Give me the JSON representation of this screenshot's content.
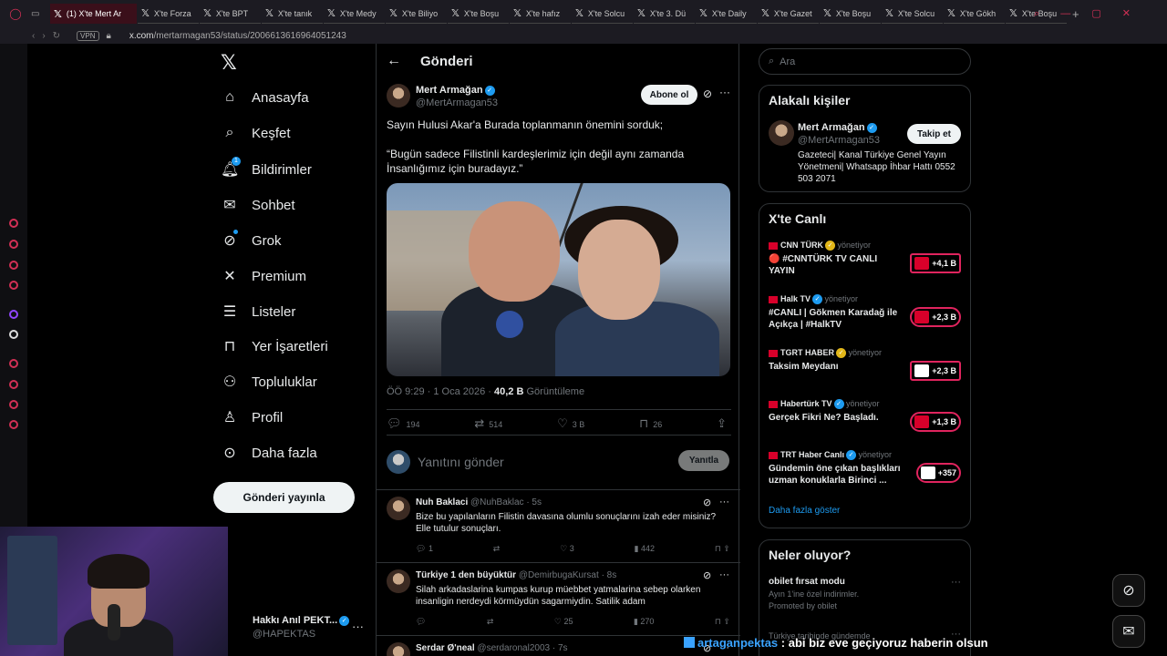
{
  "browser": {
    "tabs": [
      {
        "label": "(1) X'te Mert Ar",
        "active": true
      },
      {
        "label": "X'te Forza",
        "active": false
      },
      {
        "label": "X'te BPT",
        "active": false
      },
      {
        "label": "X'te tanık",
        "active": false
      },
      {
        "label": "X'te Medy",
        "active": false
      },
      {
        "label": "X'te Biliyo",
        "active": false
      },
      {
        "label": "X'te Boşu",
        "active": false
      },
      {
        "label": "X'te hafız",
        "active": false
      },
      {
        "label": "X'te Solcu",
        "active": false
      },
      {
        "label": "X'te 3. Dü",
        "active": false
      },
      {
        "label": "X'te Daily",
        "active": false
      },
      {
        "label": "X'te Gazet",
        "active": false
      },
      {
        "label": "X'te Boşu",
        "active": false
      },
      {
        "label": "X'te Solcu",
        "active": false
      },
      {
        "label": "X'te Gökh",
        "active": false
      },
      {
        "label": "X'te Boşu",
        "active": false
      }
    ],
    "new_tab": "+",
    "vpn": "VPN",
    "url_host": "x.com",
    "url_path": "/mertarmagan53/status/2006613616964051243"
  },
  "nav": {
    "items": [
      {
        "label": "Anasayfa",
        "icon": "home-icon",
        "glyph": "⌂"
      },
      {
        "label": "Keşfet",
        "icon": "search-icon",
        "glyph": "⌕"
      },
      {
        "label": "Bildirimler",
        "icon": "bell-icon",
        "glyph": "🔔︎"
      },
      {
        "label": "Sohbet",
        "icon": "mail-icon",
        "glyph": "✉"
      },
      {
        "label": "Grok",
        "icon": "grok-icon",
        "glyph": "⊘"
      },
      {
        "label": "Premium",
        "icon": "x-premium-icon",
        "glyph": "✕"
      },
      {
        "label": "Listeler",
        "icon": "list-icon",
        "glyph": "☰"
      },
      {
        "label": "Yer İşaretleri",
        "icon": "bookmark-icon",
        "glyph": "⊓"
      },
      {
        "label": "Topluluklar",
        "icon": "communities-icon",
        "glyph": "⚇"
      },
      {
        "label": "Profil",
        "icon": "profile-icon",
        "glyph": "♙"
      },
      {
        "label": "Daha fazla",
        "icon": "more-circle-icon",
        "glyph": "⊙"
      }
    ],
    "notification_count": "1",
    "post_button": "Gönderi yayınla",
    "account": {
      "name": "Hakkı Anıl PEKT...",
      "handle": "@HAPEKTAS"
    }
  },
  "main": {
    "title": "Gönderi",
    "post": {
      "name": "Mert Armağan",
      "handle": "@MertArmagan53",
      "subscribe": "Abone ol",
      "text1": "Sayın Hulusi Akar'a Burada toplanmanın önemini sorduk;",
      "text2": "“Bugün sadece Filistinli kardeşlerimiz için değil aynı zamanda İnsanlığımız için buradayız.”",
      "time": "ÖÖ 9:29 · 1 Oca 2026 · ",
      "views": "40,2 B",
      "views_label": " Görüntüleme",
      "replies": "194",
      "reposts": "514",
      "likes": "3 B",
      "bookmarks": "26"
    },
    "reply_box": {
      "placeholder": "Yanıtını gönder",
      "button": "Yanıtla"
    },
    "replies": [
      {
        "name": "Nuh Baklaci",
        "handle": "@NuhBaklac",
        "time": "· 5s",
        "text": "Bize bu yapılanların Filistin davasına olumlu sonuçlarını izah eder misiniz? Elle tutulur sonuçları.",
        "replies": "1",
        "reposts": "",
        "likes": "3",
        "views": "442"
      },
      {
        "name": "Türkiye 1 den büyüktür",
        "handle": "@DemirbugaKursat",
        "time": "· 8s",
        "text": "Silah arkadaslarina kumpas kurup müebbet yatmalarina sebep olarken insanligin nerdeydi körmüydün sagarmiydin. Satilik adam",
        "replies": "",
        "reposts": "",
        "likes": "25",
        "views": "270"
      },
      {
        "name": "Serdar Ø'neal",
        "handle": "@serdaronal2003",
        "time": "· 7s",
        "text": "",
        "replies": "",
        "reposts": "",
        "likes": "",
        "views": ""
      }
    ]
  },
  "right": {
    "search_placeholder": "Ara",
    "related": {
      "title": "Alakalı kişiler",
      "name": "Mert Armağan",
      "handle": "@MertArmagan53",
      "follow": "Takip et",
      "bio": "Gazeteci| Kanal Türkiye Genel Yayın Yönetmeni| Whatsapp İhbar Hattı 0552 503 2071"
    },
    "live": {
      "title": "X'te Canlı",
      "items": [
        {
          "host": "CNN TÜRK",
          "role": "yönetiyor",
          "title": "🔴 #CNNTÜRK TV CANLI YAYIN",
          "count": "+4,1 B",
          "badge_color": "#d8002a",
          "verified": "gold",
          "round": false
        },
        {
          "host": "Halk TV",
          "role": "yönetiyor",
          "title": "#CANLI | Gökmen Karadağ ile Açıkça | #HalkTV",
          "count": "+2,3 B",
          "badge_color": "#d8002a",
          "verified": "blue",
          "round": true
        },
        {
          "host": "TGRT HABER",
          "role": "yönetiyor",
          "title": "Taksim Meydanı",
          "count": "+2,3 B",
          "badge_color": "#ffffff",
          "verified": "gold",
          "round": false
        },
        {
          "host": "Habertürk TV",
          "role": "yönetiyor",
          "title": "Gerçek Fikri Ne? Başladı.",
          "count": "+1,3 B",
          "badge_color": "#d8002a",
          "verified": "blue",
          "round": true
        },
        {
          "host": "TRT Haber Canlı",
          "role": "yönetiyor",
          "title": "Gündemin öne çıkan başlıkları uzman konuklarla Birinci ...",
          "count": "+357",
          "badge_color": "#ffffff",
          "verified": "blue",
          "round": true
        }
      ],
      "show_more": "Daha fazla göster"
    },
    "trends": {
      "title": "Neler oluyor?",
      "items": [
        {
          "title": "obilet fırsat modu",
          "desc": "Ayın 1'ine özel indirimler.",
          "promo": "Promoted by obilet"
        },
        {
          "title": "",
          "desc": "Türkiye tarihinde gündemde",
          "promo": ""
        }
      ]
    }
  },
  "chat_overlay": {
    "user": "artaganpektas",
    "message": " : abi biz eve geçiyoruz haberin olsun"
  },
  "colors": {
    "accent": "#1d9bf0",
    "live_badge": "#e0245e",
    "opera": "#d23055"
  }
}
